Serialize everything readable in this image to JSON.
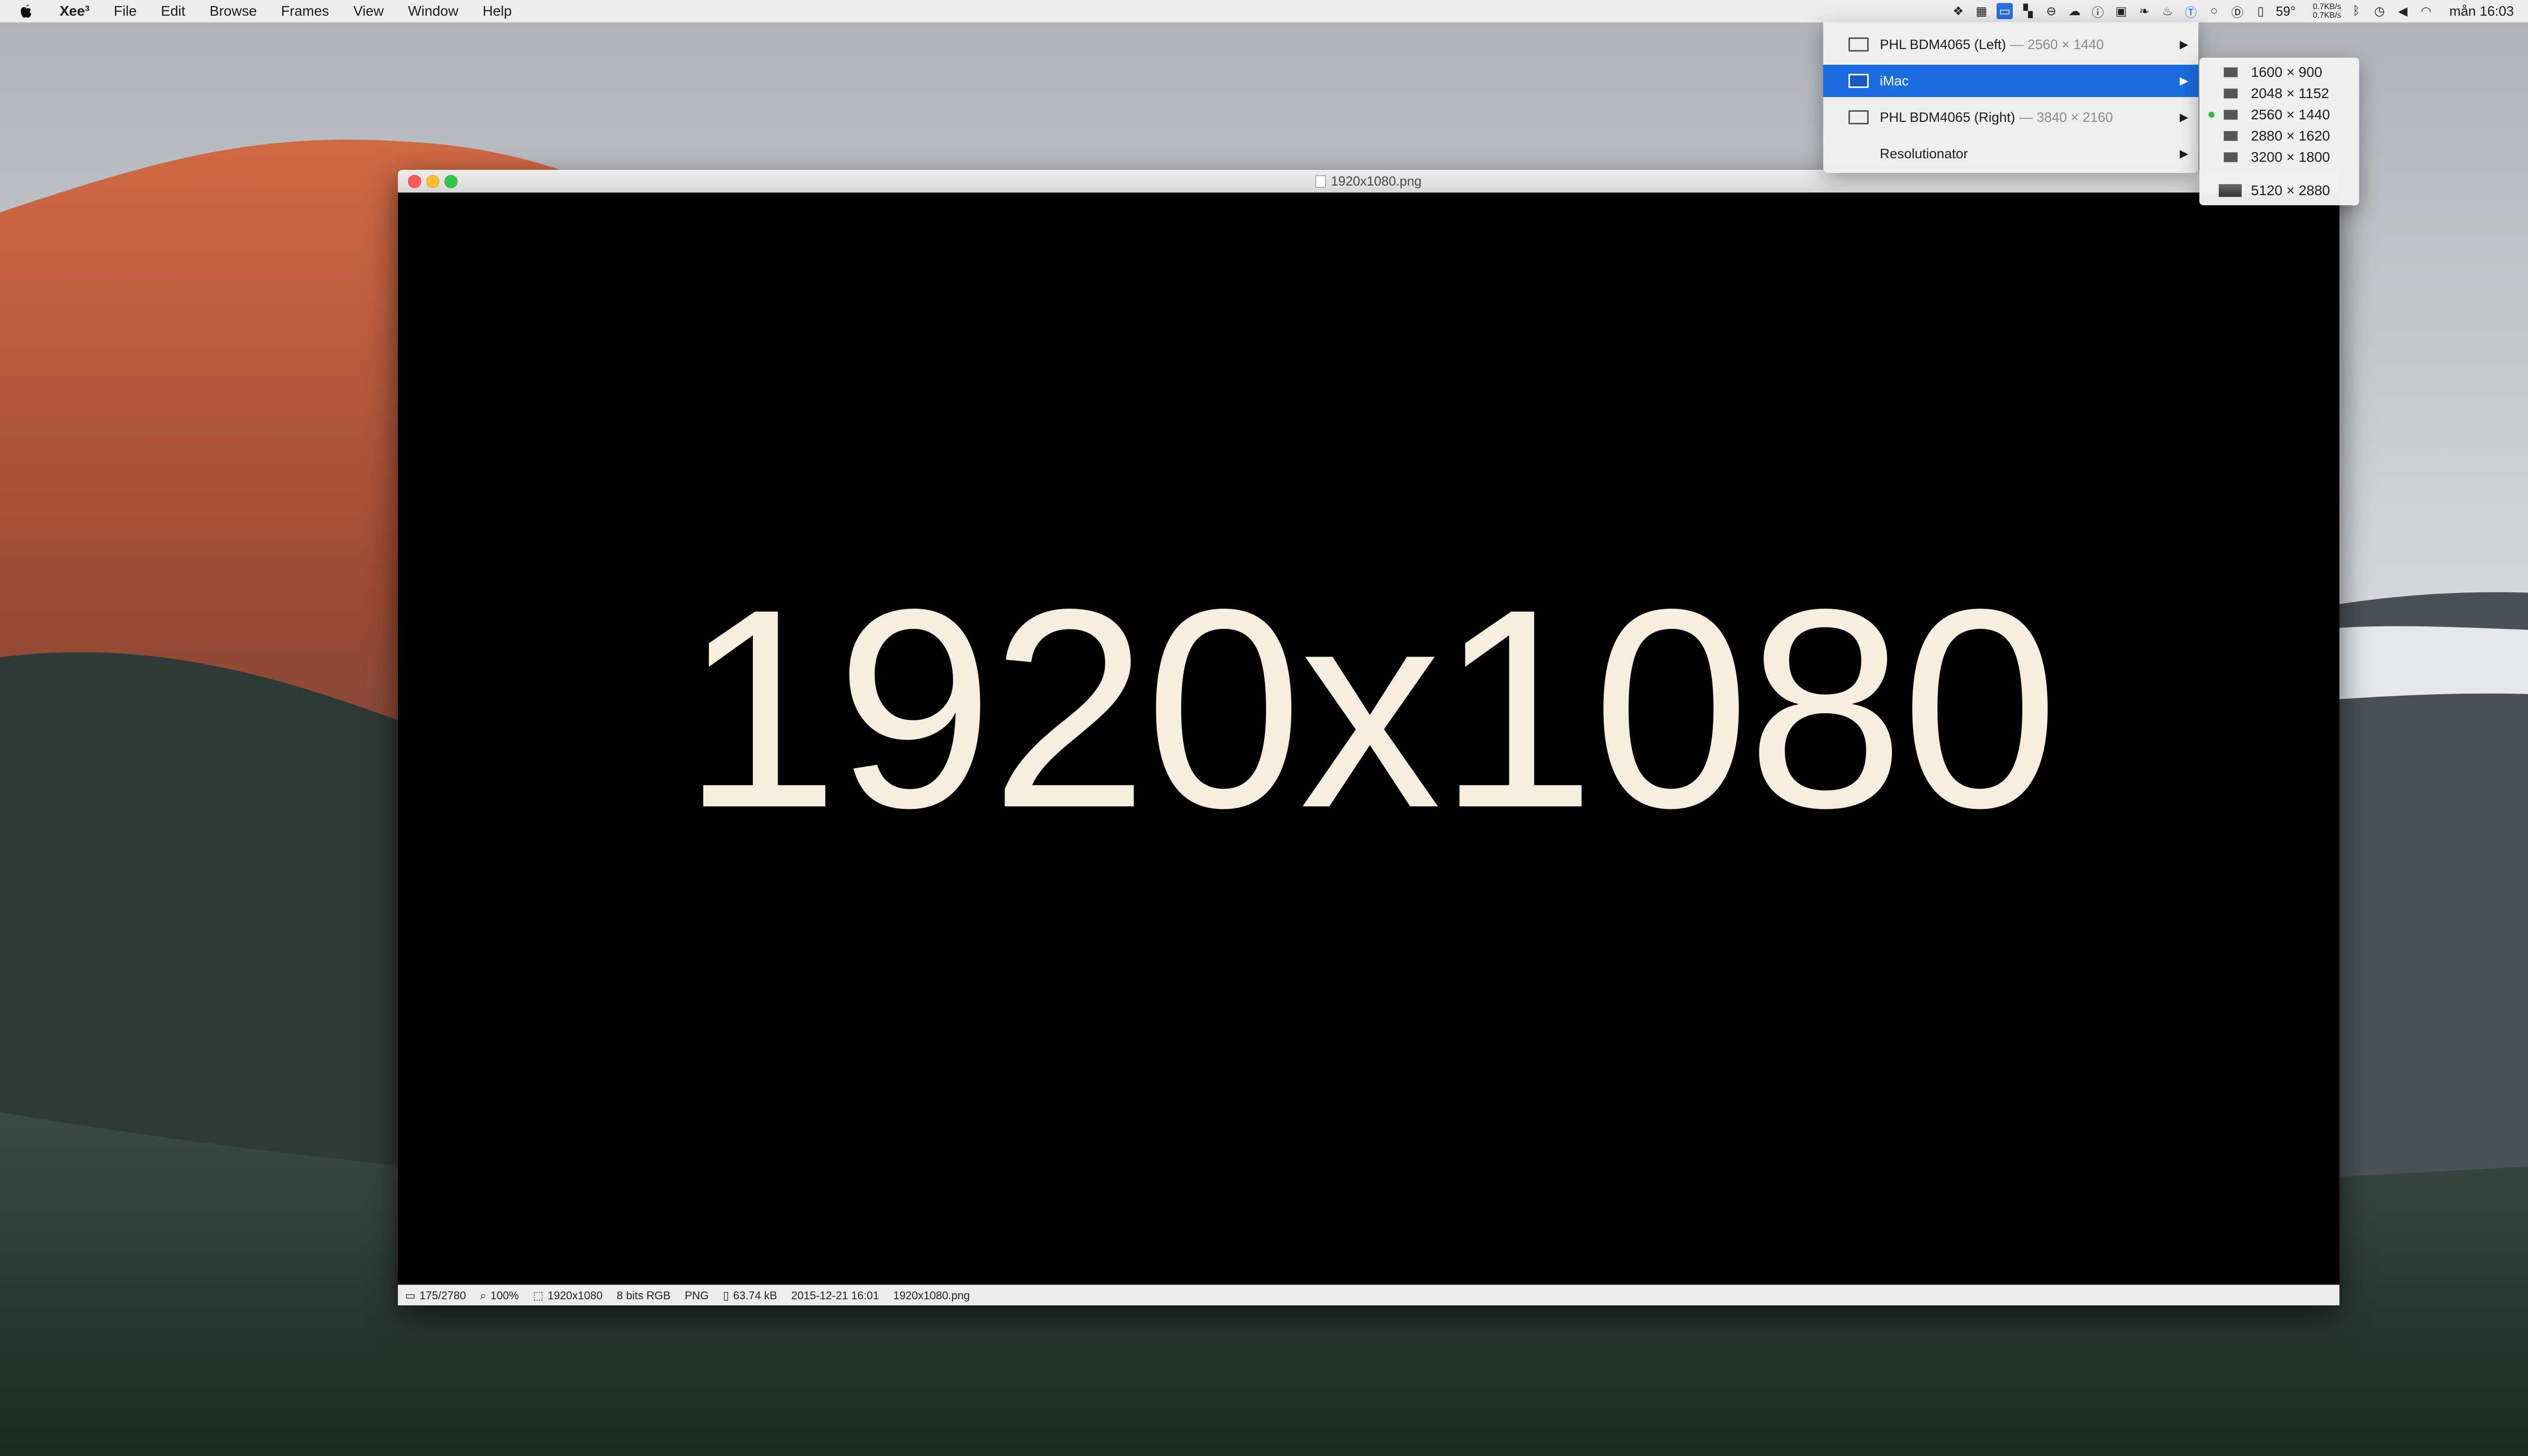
{
  "menubar": {
    "app_name": "Xee³",
    "menus": [
      "File",
      "Edit",
      "Browse",
      "Frames",
      "View",
      "Window",
      "Help"
    ],
    "tray_icons": [
      "dropbox-icon",
      "calendar-icon",
      "display-icon",
      "grid-icon",
      "minus-icon",
      "cloud-icon",
      "info-icon",
      "image-icon",
      "leaf-icon",
      "flame-icon",
      "t-icon",
      "circle-icon",
      "d-icon",
      "phone-icon"
    ],
    "temperature": "59°",
    "net_up": "0.7KB/s",
    "net_down": "0.7KB/s",
    "clock": "mån 16:03"
  },
  "display_menu": {
    "items": [
      {
        "label": "PHL BDM4065 (Left)",
        "resolution": "— 2560 × 1440"
      },
      {
        "label": "iMac",
        "resolution": ""
      },
      {
        "label": "PHL BDM4065 (Right)",
        "resolution": "— 3840 × 2160"
      },
      {
        "label": "Resolutionator",
        "resolution": ""
      }
    ]
  },
  "resolution_menu": {
    "items": [
      "1600 × 900",
      "2048 × 1152",
      "2560 × 1440",
      "2880 × 1620",
      "3200 × 1800",
      "5120 × 2880"
    ],
    "selected": "2560 × 1440"
  },
  "window": {
    "title": "1920x1080.png",
    "image_text": "1920x1080",
    "status": {
      "index": "175/2780",
      "zoom": "100%",
      "dimensions": "1920x1080",
      "color": "8 bits RGB",
      "format": "PNG",
      "filesize": "63.74 kB",
      "date": "2015-12-21 16:01",
      "filename": "1920x1080.png"
    }
  }
}
